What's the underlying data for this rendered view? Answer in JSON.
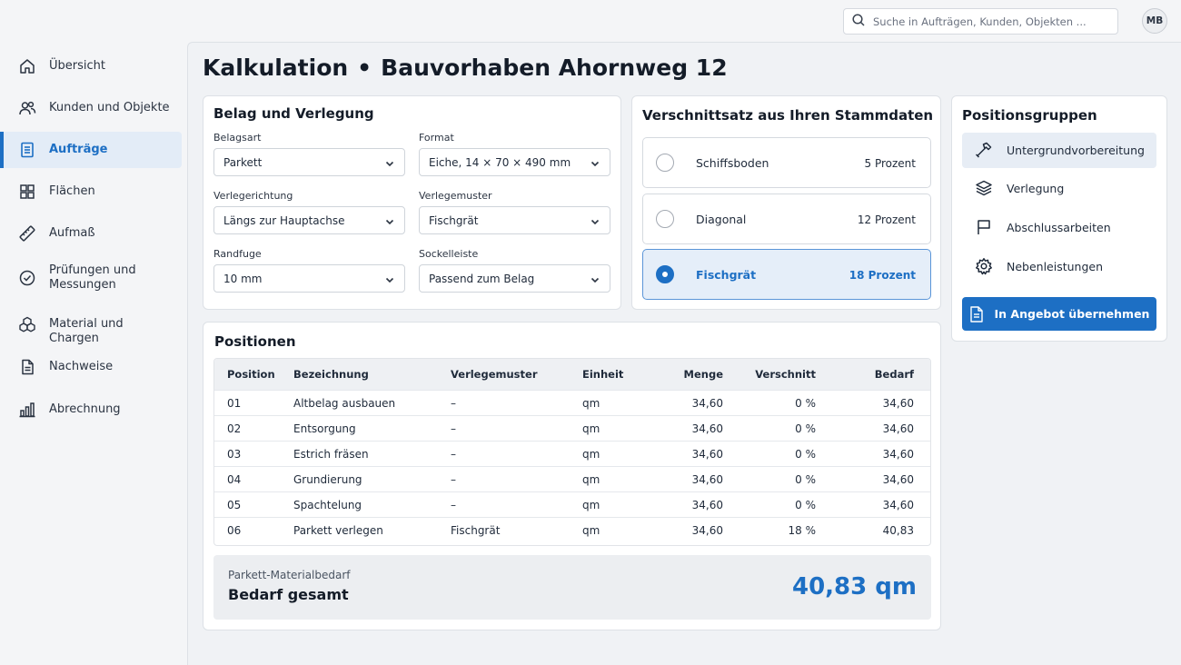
{
  "search": {
    "placeholder": "Suche in Aufträgen, Kunden, Objekten ..."
  },
  "user": {
    "initials": "MB"
  },
  "sidebar": {
    "items": [
      {
        "label": "Übersicht",
        "icon": "home-icon",
        "active": false
      },
      {
        "label": "Kunden und Objekte",
        "icon": "users-icon",
        "active": false
      },
      {
        "label": "Aufträge",
        "icon": "document-icon",
        "active": true
      },
      {
        "label": "Flächen",
        "icon": "grid-icon",
        "active": false
      },
      {
        "label": "Aufmaß",
        "icon": "ruler-icon",
        "active": false
      },
      {
        "label": "Prüfungen und Messungen",
        "icon": "check-circle-icon",
        "active": false
      },
      {
        "label": "Material und Chargen",
        "icon": "boxes-icon",
        "active": false
      },
      {
        "label": "Nachweise",
        "icon": "file-icon",
        "active": false
      },
      {
        "label": "Abrechnung",
        "icon": "bar-chart-icon",
        "active": false
      }
    ]
  },
  "header": {
    "title": "Kalkulation",
    "separator": "•",
    "project": "Bauvorhaben Ahornweg 12"
  },
  "belag": {
    "title": "Belag und Verlegung",
    "fields": {
      "belagsart": {
        "label": "Belagsart",
        "value": "Parkett"
      },
      "format": {
        "label": "Format",
        "value": "Eiche, 14 × 70 × 490 mm"
      },
      "verlegerichtung": {
        "label": "Verlegerichtung",
        "value": "Längs zur Hauptachse"
      },
      "verlegemuster": {
        "label": "Verlegemuster",
        "value": "Fischgrät"
      },
      "randfuge": {
        "label": "Randfuge",
        "value": "10 mm"
      },
      "sockelleiste": {
        "label": "Sockelleiste",
        "value": "Passend zum Belag"
      }
    }
  },
  "verschnitt": {
    "title": "Verschnittsatz aus Ihren Stammdaten",
    "options": [
      {
        "name": "Schiffsboden",
        "pct": "5 Prozent",
        "selected": false
      },
      {
        "name": "Diagonal",
        "pct": "12 Prozent",
        "selected": false
      },
      {
        "name": "Fischgrät",
        "pct": "18 Prozent",
        "selected": true
      }
    ]
  },
  "gruppen": {
    "title": "Positionsgruppen",
    "items": [
      {
        "label": "Untergrundvorbereitung",
        "icon": "hammer-icon",
        "active": true
      },
      {
        "label": "Verlegung",
        "icon": "layers-icon",
        "active": false
      },
      {
        "label": "Abschlussarbeiten",
        "icon": "flag-icon",
        "active": false
      },
      {
        "label": "Nebenleistungen",
        "icon": "gear-icon",
        "active": false
      }
    ],
    "button": "In Angebot übernehmen"
  },
  "positionen": {
    "title": "Positionen",
    "columns": {
      "pos": "Position",
      "bez": "Bezeichnung",
      "ver": "Verlegemuster",
      "ein": "Einheit",
      "men": "Menge",
      "vs": "Verschnitt",
      "bed": "Bedarf"
    },
    "rows": [
      {
        "pos": "01",
        "bez": "Altbelag ausbauen",
        "ver": "–",
        "ein": "qm",
        "men": "34,60",
        "vs": "0 %",
        "bed": "34,60"
      },
      {
        "pos": "02",
        "bez": "Entsorgung",
        "ver": "–",
        "ein": "qm",
        "men": "34,60",
        "vs": "0 %",
        "bed": "34,60"
      },
      {
        "pos": "03",
        "bez": "Estrich fräsen",
        "ver": "–",
        "ein": "qm",
        "men": "34,60",
        "vs": "0 %",
        "bed": "34,60"
      },
      {
        "pos": "04",
        "bez": "Grundierung",
        "ver": "–",
        "ein": "qm",
        "men": "34,60",
        "vs": "0 %",
        "bed": "34,60"
      },
      {
        "pos": "05",
        "bez": "Spachtelung",
        "ver": "–",
        "ein": "qm",
        "men": "34,60",
        "vs": "0 %",
        "bed": "34,60"
      },
      {
        "pos": "06",
        "bez": "Parkett verlegen",
        "ver": "Fischgrät",
        "ein": "qm",
        "men": "34,60",
        "vs": "18 %",
        "bed": "40,83"
      }
    ],
    "summary": {
      "sub": "Parkett-Materialbedarf",
      "label": "Bedarf gesamt",
      "total": "40,83 qm"
    }
  }
}
